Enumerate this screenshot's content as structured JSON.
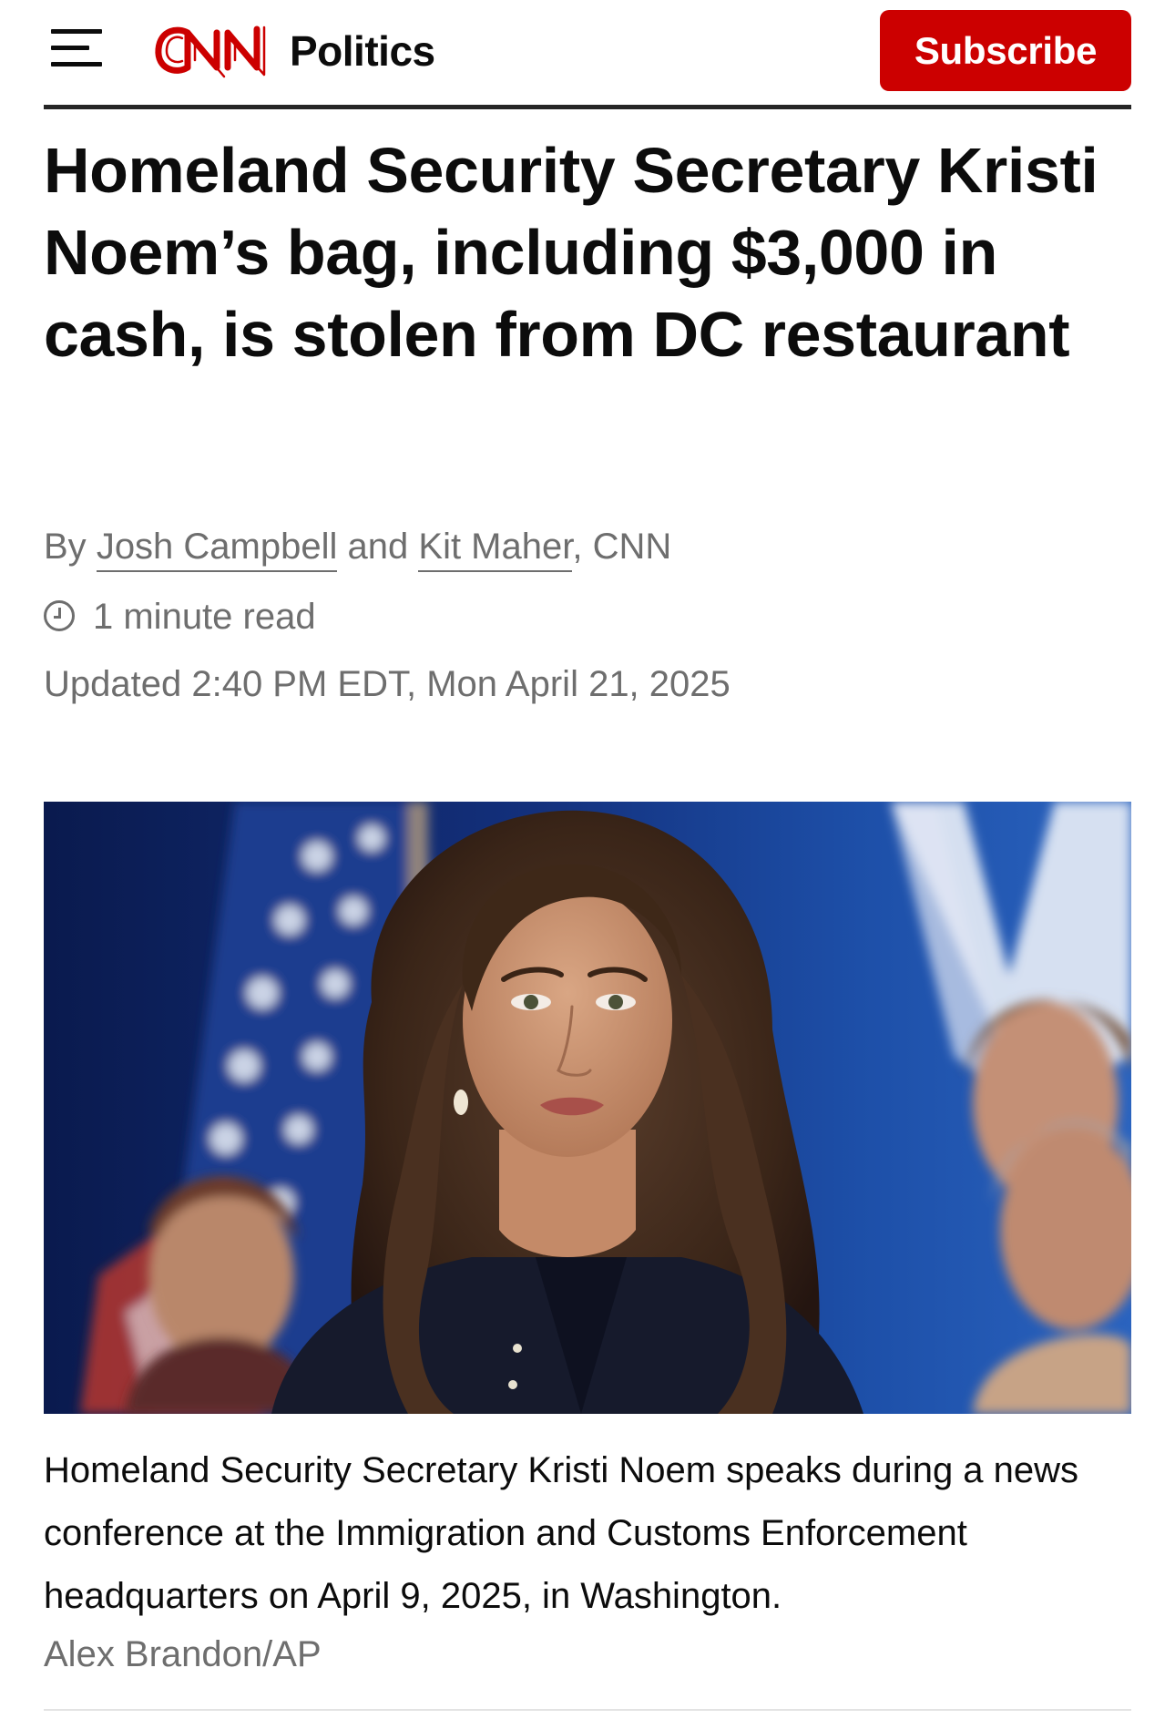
{
  "header": {
    "brand": "CNN",
    "section": "Politics",
    "subscribe_label": "Subscribe"
  },
  "article": {
    "headline": "Homeland Security Secretary Kristi Noem’s bag, including $3,000 in cash, is stolen from DC restaurant",
    "byline": {
      "prefix": "By",
      "author_1": "Josh Campbell",
      "joiner": "and",
      "author_2": "Kit Maher",
      "suffix": ", CNN"
    },
    "read_time": "1 minute read",
    "updated": "Updated 2:40 PM EDT, Mon April 21, 2025"
  },
  "photo": {
    "caption": "Homeland Security Secretary Kristi Noem speaks during a news conference at the Immigration and Customs Enforcement headquarters on April 9, 2025, in Washington.",
    "credit": "Alex Brandon/AP"
  },
  "colors": {
    "brand_red": "#cc0000",
    "text": "#0c0c0c",
    "meta_gray": "#6e6e6e"
  },
  "icons": {
    "menu": "hamburger-menu-icon",
    "read_time": "clock-icon"
  }
}
